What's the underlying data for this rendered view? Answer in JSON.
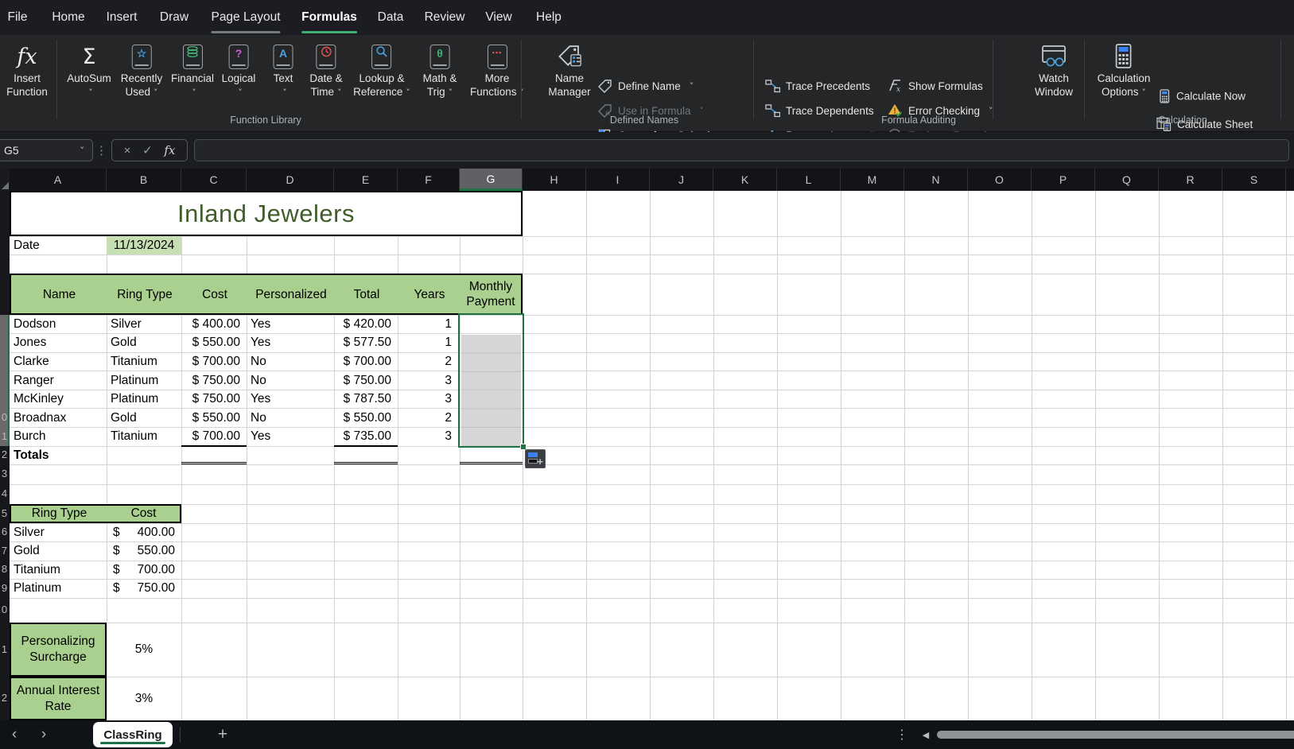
{
  "menu": {
    "tabs": [
      "File",
      "Home",
      "Insert",
      "Draw",
      "Page Layout",
      "Formulas",
      "Data",
      "Review",
      "View",
      "Help"
    ],
    "active_tab": "Formulas",
    "gray_underline_tab": "Page Layout"
  },
  "ribbon": {
    "function_library": {
      "group_label": "Function Library",
      "insert_function": [
        "Insert",
        "Function"
      ],
      "autosum": "AutoSum",
      "recently_used": [
        "Recently",
        "Used"
      ],
      "financial": "Financial",
      "logical": "Logical",
      "text": "Text",
      "date_time": [
        "Date &",
        "Time"
      ],
      "lookup_reference": [
        "Lookup &",
        "Reference"
      ],
      "math_trig": [
        "Math &",
        "Trig"
      ],
      "more_functions": [
        "More",
        "Functions"
      ]
    },
    "defined_names": {
      "group_label": "Defined Names",
      "name_manager": [
        "Name",
        "Manager"
      ],
      "define_name": "Define Name",
      "use_in_formula": "Use in Formula",
      "create_from_selection": "Create from Selection"
    },
    "formula_auditing": {
      "group_label": "Formula Auditing",
      "trace_precedents": "Trace Precedents",
      "trace_dependents": "Trace Dependents",
      "remove_arrows": "Remove Arrows",
      "show_formulas": "Show Formulas",
      "error_checking": "Error Checking",
      "evaluate_formula": "Evaluate Formula",
      "watch_window": [
        "Watch",
        "Window"
      ]
    },
    "calculation": {
      "group_label": "Calculation",
      "calculation_options": [
        "Calculation",
        "Options"
      ],
      "calculate_now": "Calculate Now",
      "calculate_sheet": "Calculate Sheet"
    }
  },
  "formula_bar": {
    "name_box": "G5",
    "formula": ""
  },
  "sheet": {
    "column_headers": [
      "A",
      "B",
      "C",
      "D",
      "E",
      "F",
      "G",
      "H",
      "I",
      "J",
      "K",
      "L",
      "M",
      "N",
      "O",
      "P",
      "Q",
      "R",
      "S"
    ],
    "selected_column": "G",
    "selected_range_rows": "5-11",
    "row_labels": [
      "",
      "",
      "",
      "",
      "",
      "",
      "",
      "",
      "",
      "0",
      "1",
      "2",
      "3",
      "4",
      "5",
      "6",
      "7",
      "8",
      "9",
      "0",
      "1",
      "2"
    ],
    "title": "Inland Jewelers",
    "date_label": "Date",
    "date_value": "11/13/2024",
    "table": {
      "headers": [
        "Name",
        "Ring Type",
        "Cost",
        "Personalized",
        "Total",
        "Years",
        "Monthly Payment"
      ],
      "rows": [
        {
          "name": "Dodson",
          "ring": "Silver",
          "cost": "$ 400.00",
          "personalized": "Yes",
          "total": "$ 420.00",
          "years": "1"
        },
        {
          "name": "Jones",
          "ring": "Gold",
          "cost": "$ 550.00",
          "personalized": "Yes",
          "total": "$ 577.50",
          "years": "1"
        },
        {
          "name": "Clarke",
          "ring": "Titanium",
          "cost": "$ 700.00",
          "personalized": "No",
          "total": "$ 700.00",
          "years": "2"
        },
        {
          "name": "Ranger",
          "ring": "Platinum",
          "cost": "$ 750.00",
          "personalized": "No",
          "total": "$ 750.00",
          "years": "3"
        },
        {
          "name": "McKinley",
          "ring": "Platinum",
          "cost": "$ 750.00",
          "personalized": "Yes",
          "total": "$ 787.50",
          "years": "3"
        },
        {
          "name": "Broadnax",
          "ring": "Gold",
          "cost": "$ 550.00",
          "personalized": "No",
          "total": "$ 550.00",
          "years": "2"
        },
        {
          "name": "Burch",
          "ring": "Titanium",
          "cost": "$ 700.00",
          "personalized": "Yes",
          "total": "$ 735.00",
          "years": "3"
        }
      ],
      "totals_label": "Totals"
    },
    "lookup": {
      "headers": [
        "Ring Type",
        "Cost"
      ],
      "rows": [
        {
          "type": "Silver",
          "sign": "$",
          "amount": "400.00"
        },
        {
          "type": "Gold",
          "sign": "$",
          "amount": "550.00"
        },
        {
          "type": "Titanium",
          "sign": "$",
          "amount": "700.00"
        },
        {
          "type": "Platinum",
          "sign": "$",
          "amount": "750.00"
        }
      ]
    },
    "surcharge_label": "Personalizing Surcharge",
    "surcharge_value": "5%",
    "interest_label": "Annual Interest Rate",
    "interest_value": "3%"
  },
  "sheet_tabs": {
    "active": "ClassRing"
  },
  "glyphs": {
    "chevron_down": "˅",
    "kebab": "⋮",
    "cancel": "×",
    "check": "✓",
    "fx": "fx",
    "sigma": "Σ",
    "star": "☆",
    "question": "?",
    "letter_a": "A",
    "theta": "θ",
    "dots": "•••",
    "chevron_left": "‹",
    "chevron_right": "›",
    "scroll_left_arrow": "◀",
    "plus": "+"
  },
  "colors": {
    "accent_green": "#3fae72",
    "selection_green": "#1f7145",
    "header_fill": "#A9D08E",
    "date_fill": "#C6E0B4",
    "title_text": "#3f5e2a"
  }
}
